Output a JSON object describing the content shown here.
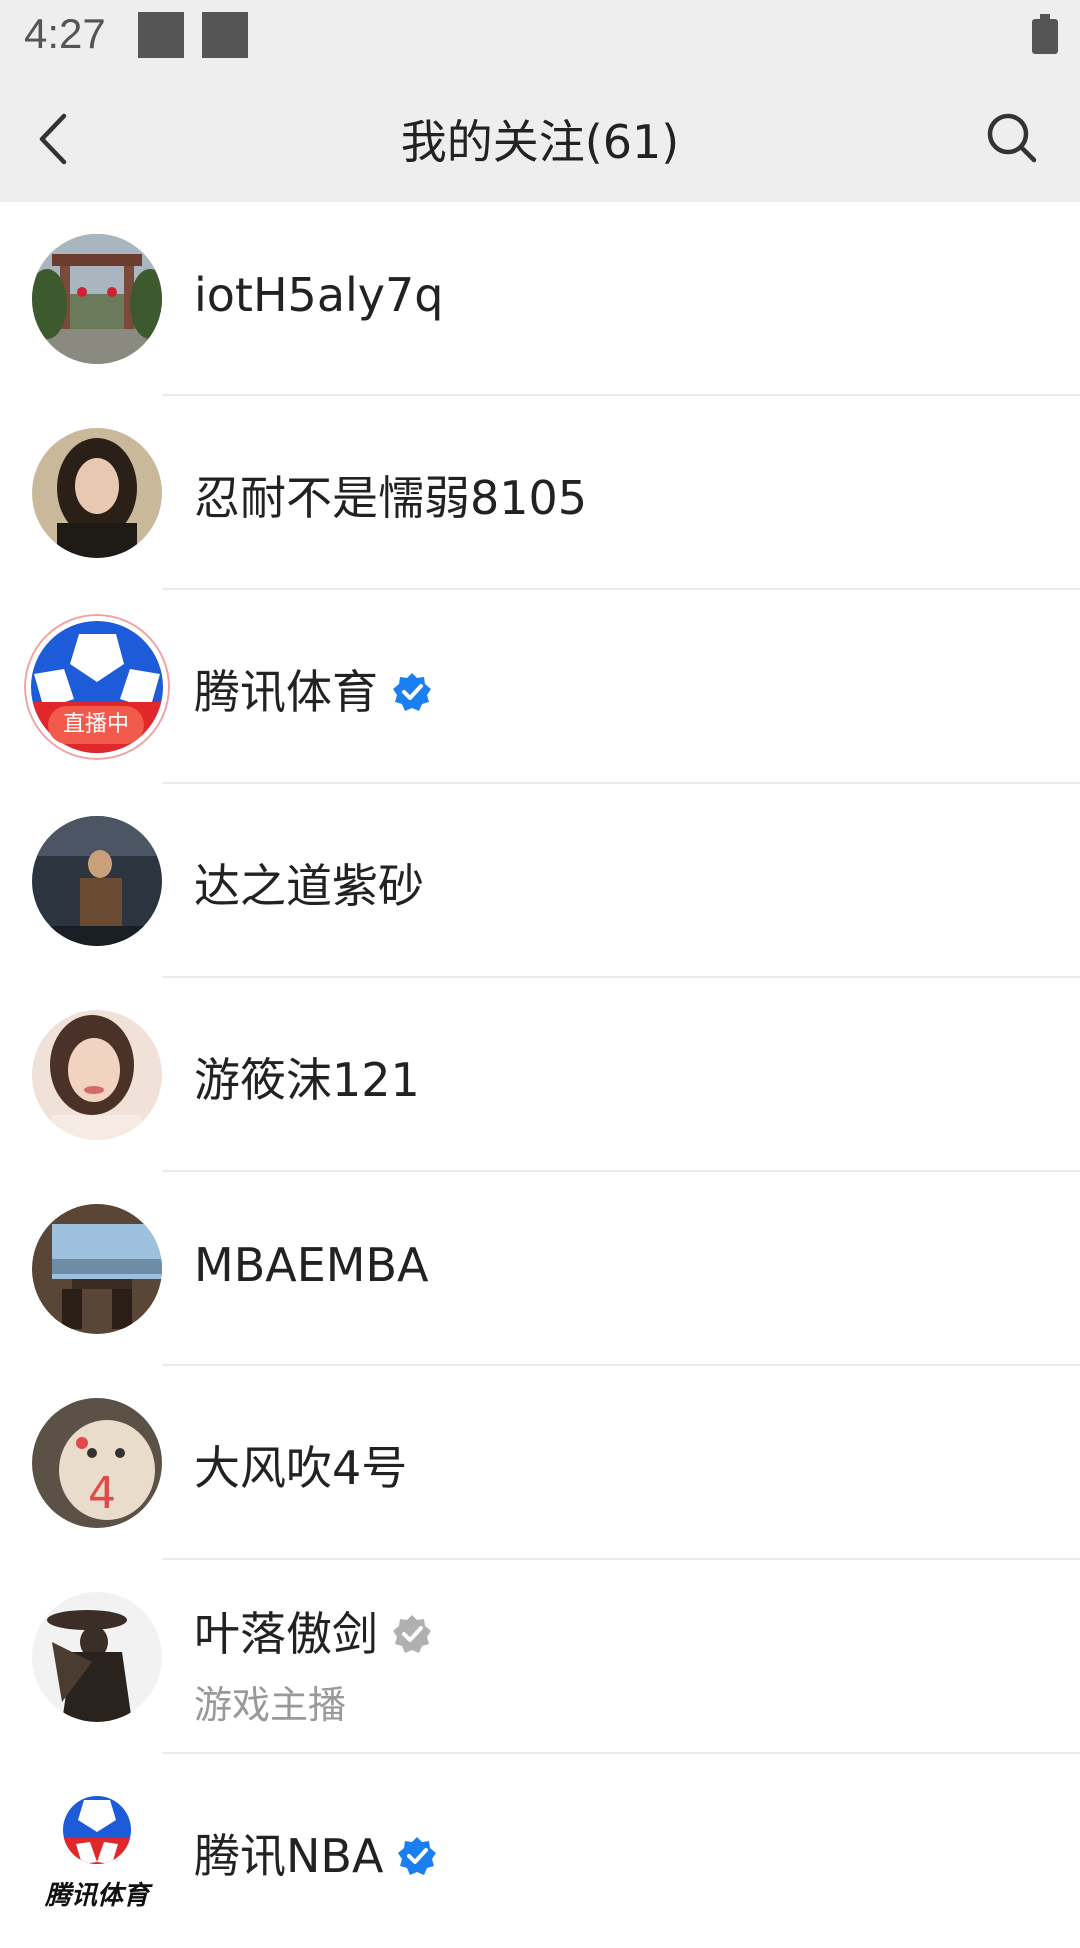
{
  "status_bar": {
    "time": "4:27"
  },
  "nav": {
    "title": "我的关注(61)",
    "back_icon": "chevron-left-icon",
    "search_icon": "search-icon"
  },
  "colors": {
    "bar_bg": "#eeeeee",
    "verified_blue": "#1a7ff0",
    "verified_gray": "#b0b0b0",
    "live_badge": "#f25b4c"
  },
  "follows": [
    {
      "name": "iotH5aly7q",
      "verified": "none"
    },
    {
      "name": "忍耐不是懦弱8105",
      "verified": "none"
    },
    {
      "name": "腾讯体育",
      "verified": "blue",
      "live_badge": "直播中"
    },
    {
      "name": "达之道紫砂",
      "verified": "none"
    },
    {
      "name": "游筱沫121",
      "verified": "none"
    },
    {
      "name": "MBAEMBA",
      "verified": "none"
    },
    {
      "name": "大风吹4号",
      "verified": "none"
    },
    {
      "name": "叶落傲剑",
      "verified": "gray",
      "subtitle": "游戏主播"
    },
    {
      "name": "腾讯NBA",
      "verified": "blue",
      "logo_text": "腾讯体育"
    }
  ]
}
